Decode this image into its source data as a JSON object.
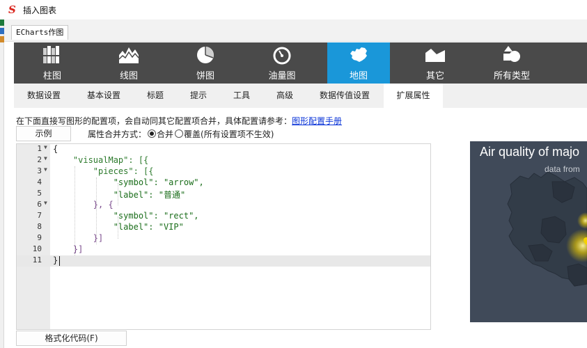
{
  "window": {
    "title": "插入图表",
    "logo_icon": "app-logo-icon"
  },
  "doc_tab": {
    "label": "ECharts作图"
  },
  "chart_types": [
    {
      "label": "柱图",
      "icon": "bar-chart-icon"
    },
    {
      "label": "线图",
      "icon": "line-chart-icon"
    },
    {
      "label": "饼图",
      "icon": "pie-chart-icon"
    },
    {
      "label": "油量图",
      "icon": "gauge-icon"
    },
    {
      "label": "地图",
      "icon": "map-icon",
      "active": true
    },
    {
      "label": "其它",
      "icon": "other-chart-icon"
    },
    {
      "label": "所有类型",
      "icon": "all-types-icon"
    }
  ],
  "sub_tabs": [
    {
      "label": "数据设置"
    },
    {
      "label": "基本设置"
    },
    {
      "label": "标题"
    },
    {
      "label": "提示"
    },
    {
      "label": "工具"
    },
    {
      "label": "高级"
    },
    {
      "label": "数据传值设置"
    },
    {
      "label": "扩展属性",
      "active": true
    }
  ],
  "hint": {
    "text": "在下面直接写图形的配置项，会自动同其它配置项合并，具体配置请参考：",
    "link": "图形配置手册"
  },
  "example_button": "示例",
  "merge": {
    "label": "属性合并方式：",
    "option_merge": "合并",
    "option_override": "覆盖(所有设置项不生效)",
    "selected": "合并"
  },
  "editor": {
    "lines": [
      "{",
      "    \"visualMap\": [{",
      "        \"pieces\": [{",
      "            \"symbol\": \"arrow\",",
      "            \"label\": \"普通\"",
      "        }, {",
      "            \"symbol\": \"rect\",",
      "            \"label\": \"VIP\"",
      "        }]",
      "    }]",
      "}"
    ],
    "current_line": 11
  },
  "format_button": "格式化代码(F)",
  "preview": {
    "title": "Air quality of majo",
    "subtitle": "data from"
  },
  "colors": {
    "chart_bar": "#4a4a4a",
    "active_type": "#1a97d9",
    "preview_bg": "#404a59",
    "link": "#0a34d8"
  }
}
